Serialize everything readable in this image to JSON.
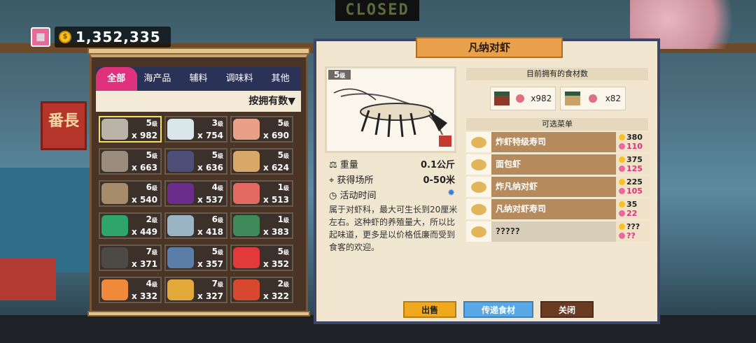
{
  "header": {
    "money": "1,352,335"
  },
  "background": {
    "sign_text": "CLOSED",
    "shop_text": "番長"
  },
  "inventory": {
    "tabs": [
      "全部",
      "海产品",
      "辅料",
      "调味料",
      "其他"
    ],
    "sort_label": "按拥有数▼",
    "items": [
      {
        "level": "5",
        "qty": "x 982",
        "color": "#b9b3a8"
      },
      {
        "level": "3",
        "qty": "x 754",
        "color": "#d9e6ea"
      },
      {
        "level": "5",
        "qty": "x 690",
        "color": "#e8a089"
      },
      {
        "level": "5",
        "qty": "x 663",
        "color": "#9a8d7d"
      },
      {
        "level": "5",
        "qty": "x 636",
        "color": "#4e4f78"
      },
      {
        "level": "5",
        "qty": "x 624",
        "color": "#d8a868"
      },
      {
        "level": "6",
        "qty": "x 540",
        "color": "#a68c6a"
      },
      {
        "level": "4",
        "qty": "x 537",
        "color": "#6a2e8a"
      },
      {
        "level": "1",
        "qty": "x 513",
        "color": "#e36a62"
      },
      {
        "level": "2",
        "qty": "x 449",
        "color": "#2ea56a"
      },
      {
        "level": "6",
        "qty": "x 418",
        "color": "#9ab4c6"
      },
      {
        "level": "1",
        "qty": "x 383",
        "color": "#3f8a5a"
      },
      {
        "level": "7",
        "qty": "x 371",
        "color": "#4d4a46"
      },
      {
        "level": "5",
        "qty": "x 357",
        "color": "#5a7ea8"
      },
      {
        "level": "5",
        "qty": "x 352",
        "color": "#e23a3a"
      },
      {
        "level": "4",
        "qty": "x 332",
        "color": "#f08a3a"
      },
      {
        "level": "7",
        "qty": "x 327",
        "color": "#e3a83a"
      },
      {
        "level": "2",
        "qty": "x 322",
        "color": "#d8482e"
      }
    ]
  },
  "detail": {
    "title": "凡纳对虾",
    "level": "5",
    "level_unit": "级",
    "stats": [
      {
        "label": "重量",
        "value": "0.1公斤"
      },
      {
        "label": "获得场所",
        "value": "0-50米"
      },
      {
        "label": "活动时间",
        "value": ""
      }
    ],
    "description": "属于对虾科，最大可生长到20厘米左右。这种虾的养殖量大，所以比起味道，更多是以价格低廉而受到食客的欢迎。",
    "owned_header": "目前拥有的食材数",
    "owned": [
      {
        "qty": "x982"
      },
      {
        "qty": "x82"
      }
    ],
    "menu_header": "可选菜单",
    "menu": [
      {
        "name": "炸虾特级寿司",
        "gold": "380",
        "pink": "110"
      },
      {
        "name": "面包虾",
        "gold": "375",
        "pink": "125"
      },
      {
        "name": "炸凡纳对虾",
        "gold": "225",
        "pink": "105"
      },
      {
        "name": "凡纳对虾寿司",
        "gold": "35",
        "pink": "22"
      },
      {
        "name": "?????",
        "gold": "???",
        "pink": "??"
      }
    ],
    "buttons": {
      "sell": "出售",
      "send": "传递食材",
      "close": "关闭"
    }
  }
}
